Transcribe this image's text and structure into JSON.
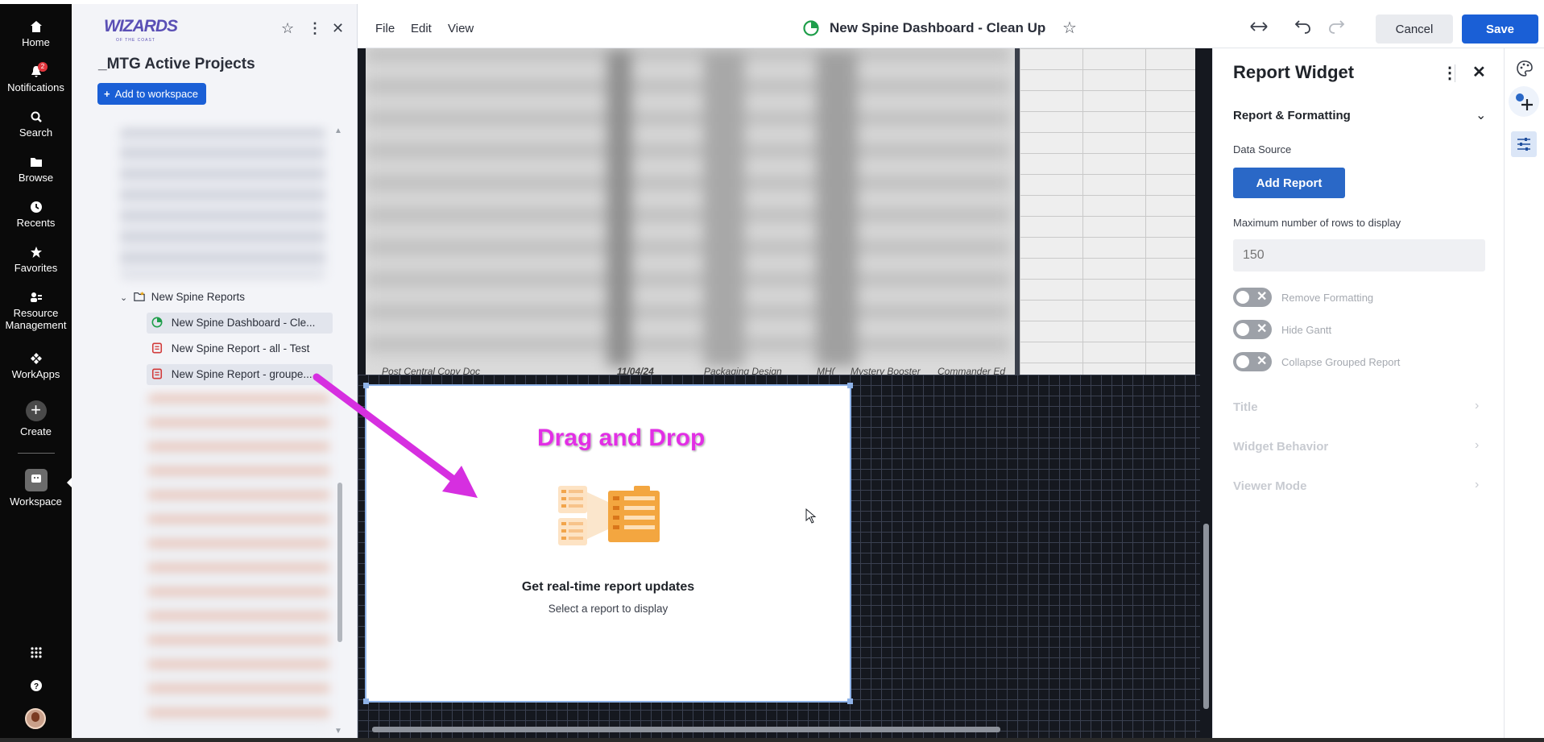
{
  "leftnav": {
    "items": [
      {
        "label": "Home",
        "icon": "home-icon"
      },
      {
        "label": "Notifications",
        "icon": "bell-icon",
        "badge": "2"
      },
      {
        "label": "Search",
        "icon": "search-icon"
      },
      {
        "label": "Browse",
        "icon": "folder-icon"
      },
      {
        "label": "Recents",
        "icon": "clock-icon"
      },
      {
        "label": "Favorites",
        "icon": "star-icon"
      },
      {
        "label": "Resource Management",
        "icon": "people-icon"
      },
      {
        "label": "WorkApps",
        "icon": "workapps-icon"
      },
      {
        "label": "Create",
        "icon": "plus-icon"
      },
      {
        "label": "Workspace",
        "icon": "workspace-icon"
      }
    ]
  },
  "workspace_panel": {
    "logo": "WIZARDS",
    "logo_sub": "OF THE COAST",
    "title": "_MTG Active Projects",
    "add_button": "Add to workspace",
    "folder": "New Spine Reports",
    "items": [
      {
        "label": "New Spine Dashboard - Cle...",
        "type": "dashboard"
      },
      {
        "label": "New Spine Report - all - Test",
        "type": "report"
      },
      {
        "label": "New Spine Report - groupe...",
        "type": "report"
      }
    ]
  },
  "topbar": {
    "menu": [
      "File",
      "Edit",
      "View"
    ],
    "title": "New Spine Dashboard - Clean Up",
    "cancel": "Cancel",
    "save": "Save"
  },
  "canvas": {
    "report_footer": [
      "Post Central Copy Doc",
      "11/04/24",
      "Packaging Design",
      "MH(",
      "Mystery Booster",
      "Commander Ed"
    ],
    "widget": {
      "annotation": "Drag and Drop",
      "heading": "Get real-time report updates",
      "subtext": "Select a report to display"
    }
  },
  "right_panel": {
    "title": "Report Widget",
    "section": "Report & Formatting",
    "data_source_label": "Data Source",
    "add_report": "Add Report",
    "rows_label": "Maximum number of rows to display",
    "rows_placeholder": "150",
    "toggles": [
      "Remove Formatting",
      "Hide Gantt",
      "Collapse Grouped Report"
    ],
    "collapsed_sections": [
      "Title",
      "Widget Behavior",
      "Viewer Mode"
    ]
  },
  "colors": {
    "primary": "#1a5fd6",
    "annotation": "#e22fe5",
    "nav_bg": "#0a0a0a"
  }
}
